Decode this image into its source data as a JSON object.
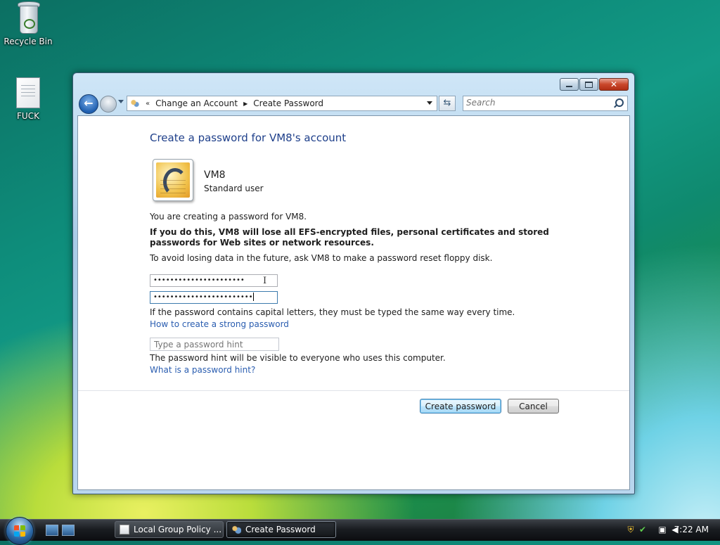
{
  "desktop": {
    "icons": [
      {
        "label": "Recycle Bin",
        "icon": "recycle-bin-icon"
      },
      {
        "label": "FUCK",
        "icon": "text-file-icon"
      }
    ]
  },
  "window": {
    "breadcrumb": {
      "overflow": "«",
      "items": [
        "Change an Account",
        "Create Password"
      ]
    },
    "search": {
      "placeholder": "Search"
    },
    "title": "Create a password for VM8's account",
    "user": {
      "name": "VM8",
      "type": "Standard user"
    },
    "intro": "You are creating a password for VM8.",
    "warning": "If you do this, VM8 will lose all EFS-encrypted files, personal certificates and stored passwords for Web sites or network resources.",
    "advice": "To avoid losing data in the future, ask VM8 to make a password reset floppy disk.",
    "password": "••••••••••••••••••••••",
    "confirm_password": "••••••••••••••••••••••••",
    "case_note": "If the password contains capital letters, they must be typed the same way every time.",
    "strong_link": "How to create a strong password",
    "hint_placeholder": "Type a password hint",
    "hint_note": "The password hint will be visible to everyone who uses this computer.",
    "hint_link": "What is a password hint?",
    "create_button": "Create password",
    "cancel_button": "Cancel"
  },
  "taskbar": {
    "tasks": [
      {
        "label": "Local Group Policy ...",
        "active": false
      },
      {
        "label": "Create Password",
        "active": true
      }
    ],
    "clock": "7:22 AM"
  },
  "colors": {
    "title": "#1e3f8a",
    "link": "#2a5db0",
    "close_button": "#c9462a"
  }
}
